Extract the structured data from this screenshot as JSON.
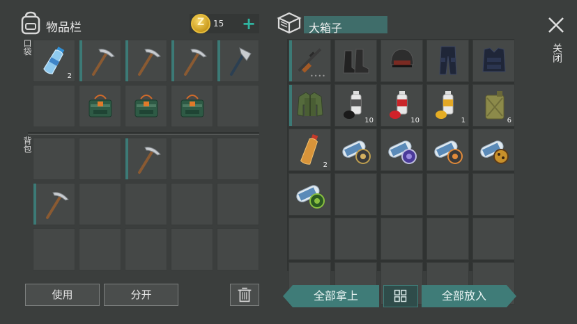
{
  "inventory": {
    "title": "物品栏",
    "pocket_label": "口袋",
    "backpack_label": "背包",
    "coins": "15",
    "pocket_slots": [
      {
        "item": "water-bottle",
        "qty": "2",
        "selected": false
      },
      {
        "item": "pickaxe",
        "qty": "",
        "selected": true
      },
      {
        "item": "pickaxe",
        "qty": "",
        "selected": true
      },
      {
        "item": "pickaxe",
        "qty": "",
        "selected": true
      },
      {
        "item": "hatchet",
        "qty": "",
        "selected": true
      },
      {
        "item": "",
        "qty": "",
        "selected": false
      },
      {
        "item": "explosive-pack",
        "qty": "",
        "selected": false
      },
      {
        "item": "explosive-pack",
        "qty": "",
        "selected": false
      },
      {
        "item": "explosive-pack",
        "qty": "",
        "selected": false
      },
      {
        "item": "",
        "qty": "",
        "selected": false
      }
    ],
    "backpack_slots": [
      {
        "item": "",
        "qty": "",
        "selected": false
      },
      {
        "item": "",
        "qty": "",
        "selected": false
      },
      {
        "item": "pickaxe",
        "qty": "",
        "selected": true
      },
      {
        "item": "",
        "qty": "",
        "selected": false
      },
      {
        "item": "",
        "qty": "",
        "selected": false
      },
      {
        "item": "pickaxe",
        "qty": "",
        "selected": true
      },
      {
        "item": "",
        "qty": "",
        "selected": false
      },
      {
        "item": "",
        "qty": "",
        "selected": false
      },
      {
        "item": "",
        "qty": "",
        "selected": false
      },
      {
        "item": "",
        "qty": "",
        "selected": false
      },
      {
        "item": "",
        "qty": "",
        "selected": false
      },
      {
        "item": "",
        "qty": "",
        "selected": false
      },
      {
        "item": "",
        "qty": "",
        "selected": false
      },
      {
        "item": "",
        "qty": "",
        "selected": false
      },
      {
        "item": "",
        "qty": "",
        "selected": false
      }
    ],
    "use_label": "使用",
    "split_label": "分开"
  },
  "chest": {
    "title": "大箱子",
    "close_label": "关闭",
    "slots": [
      {
        "item": "rifle",
        "qty": "",
        "dots": "••••",
        "selected": true
      },
      {
        "item": "boots",
        "qty": "",
        "selected": false
      },
      {
        "item": "helmet",
        "qty": "",
        "selected": false
      },
      {
        "item": "pants",
        "qty": "",
        "selected": false
      },
      {
        "item": "vest",
        "qty": "",
        "selected": false
      },
      {
        "item": "jacket",
        "qty": "",
        "selected": true
      },
      {
        "item": "spray-black",
        "qty": "10",
        "selected": false
      },
      {
        "item": "spray-red",
        "qty": "10",
        "selected": false
      },
      {
        "item": "spray-yellow",
        "qty": "1",
        "selected": false
      },
      {
        "item": "jerrycan",
        "qty": "6",
        "selected": false
      },
      {
        "item": "bottle-orange",
        "qty": "2",
        "selected": false
      },
      {
        "item": "blueprint-ammo",
        "qty": "",
        "selected": false
      },
      {
        "item": "blueprint-purple",
        "qty": "",
        "selected": false
      },
      {
        "item": "blueprint-orange",
        "qty": "",
        "selected": false
      },
      {
        "item": "blueprint-leopard",
        "qty": "",
        "selected": false
      },
      {
        "item": "blueprint-green",
        "qty": "",
        "selected": false
      },
      {
        "item": "",
        "qty": "",
        "selected": false
      },
      {
        "item": "",
        "qty": "",
        "selected": false
      },
      {
        "item": "",
        "qty": "",
        "selected": false
      },
      {
        "item": "",
        "qty": "",
        "selected": false
      },
      {
        "item": "",
        "qty": "",
        "selected": false
      },
      {
        "item": "",
        "qty": "",
        "selected": false
      },
      {
        "item": "",
        "qty": "",
        "selected": false
      },
      {
        "item": "",
        "qty": "",
        "selected": false
      },
      {
        "item": "",
        "qty": "",
        "selected": false
      },
      {
        "item": "",
        "qty": "",
        "selected": false
      },
      {
        "item": "",
        "qty": "",
        "selected": false
      },
      {
        "item": "",
        "qty": "",
        "selected": false
      },
      {
        "item": "",
        "qty": "",
        "selected": false
      },
      {
        "item": "",
        "qty": "",
        "selected": false
      }
    ],
    "take_all_label": "全部拿上",
    "put_all_label": "全部放入"
  },
  "colors": {
    "accent": "#3f7c78",
    "background": "#3b3e3d",
    "slot": "#454847"
  }
}
